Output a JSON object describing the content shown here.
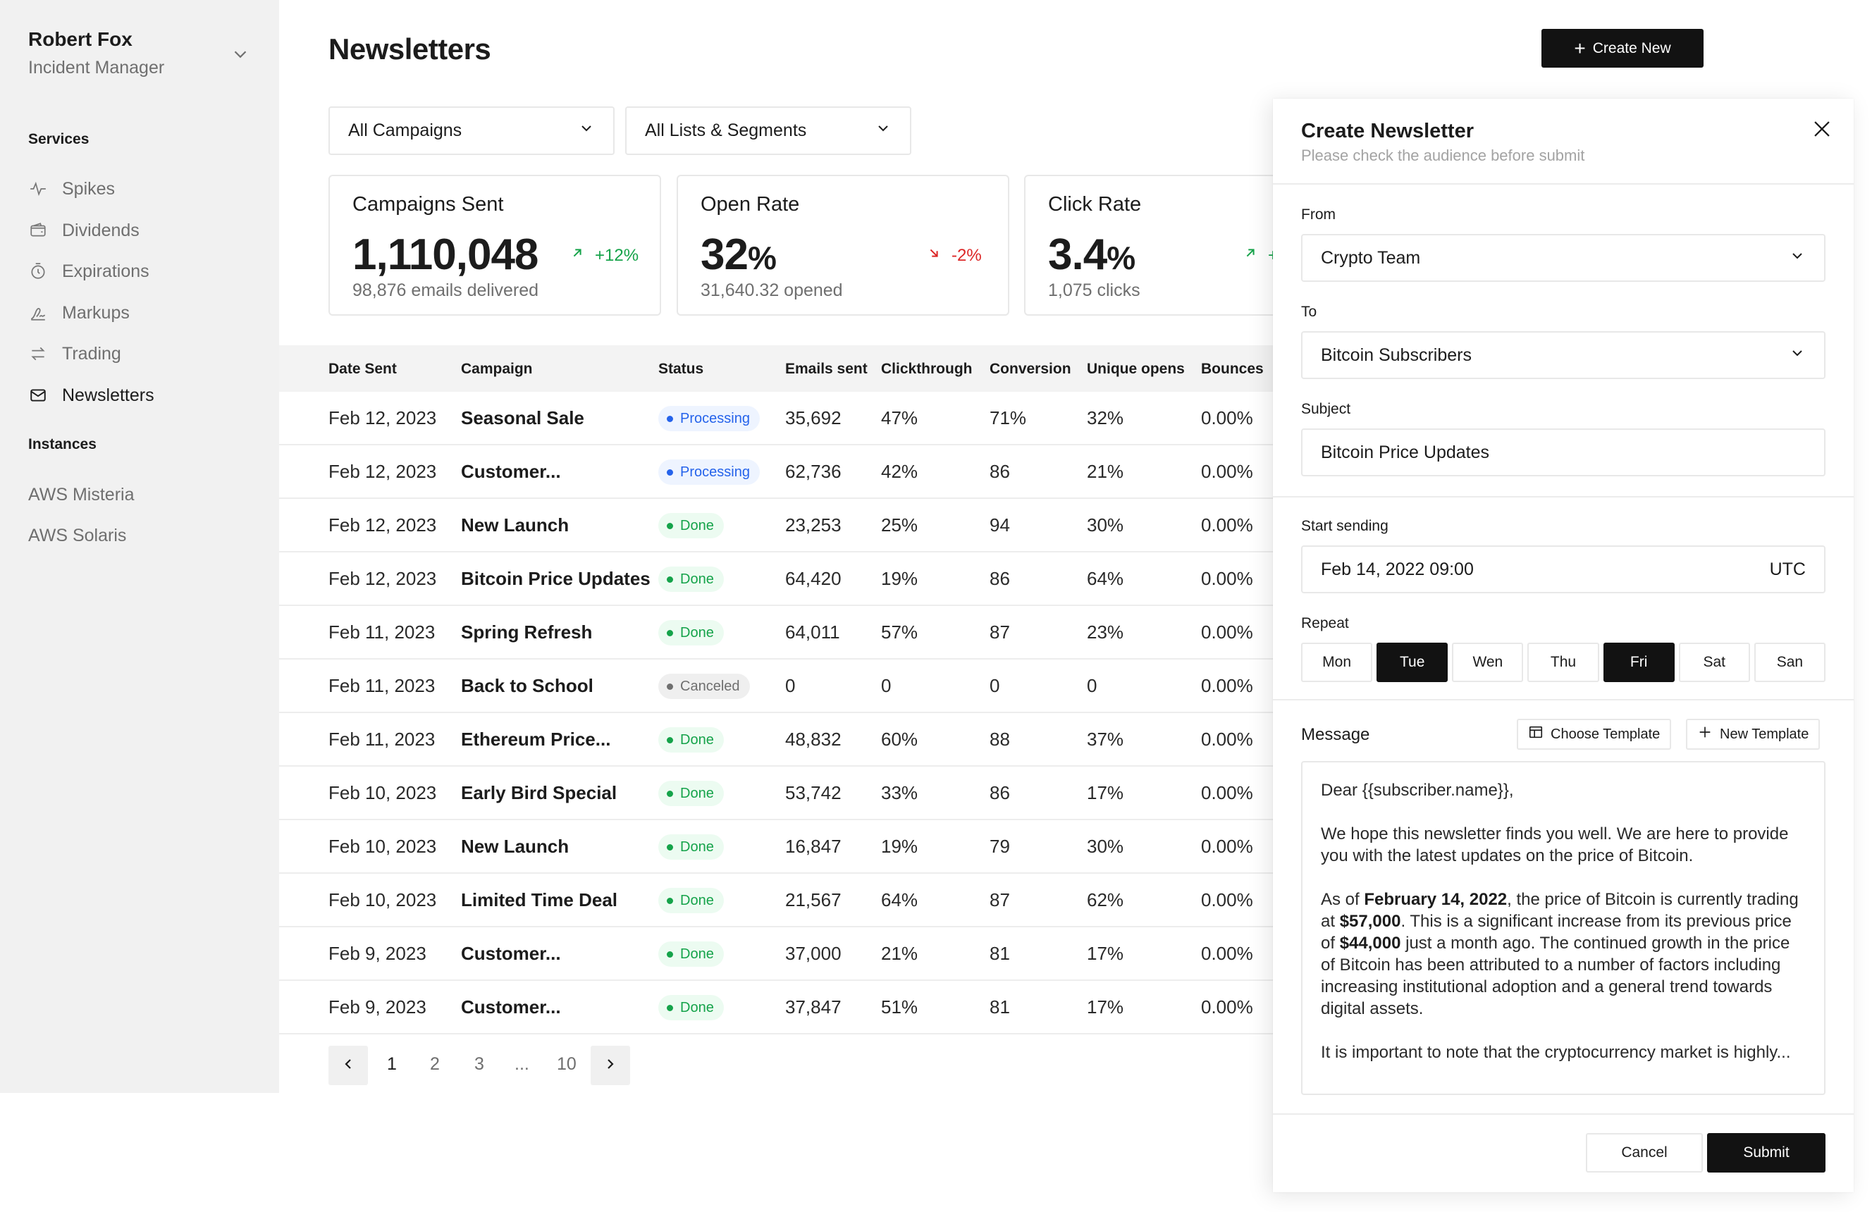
{
  "user": {
    "name": "Robert Fox",
    "role": "Incident Manager",
    "toggle_icon": "chevron-down-icon"
  },
  "sidebar": {
    "services_title": "Services",
    "items": [
      {
        "label": "Spikes",
        "icon": "activity-icon",
        "active": false
      },
      {
        "label": "Dividends",
        "icon": "wallet-icon",
        "active": false
      },
      {
        "label": "Expirations",
        "icon": "timer-icon",
        "active": false
      },
      {
        "label": "Markups",
        "icon": "signature-icon",
        "active": false
      },
      {
        "label": "Trading",
        "icon": "swap-icon",
        "active": false
      },
      {
        "label": "Newsletters",
        "icon": "mail-icon",
        "active": true
      }
    ],
    "instances_title": "Instances",
    "instances": [
      {
        "label": "AWS Misteria"
      },
      {
        "label": "AWS Solaris"
      }
    ]
  },
  "header": {
    "title": "Newsletters",
    "create_label": "Create New"
  },
  "filters": {
    "campaigns": "All Campaigns",
    "lists": "All Lists & Segments"
  },
  "stats": [
    {
      "label": "Campaigns Sent",
      "value": "1,110,048",
      "unit": "",
      "delta": "+12%",
      "trend": "up",
      "sub": "98,876 emails delivered"
    },
    {
      "label": "Open Rate",
      "value": "32",
      "unit": "%",
      "delta": "-2%",
      "trend": "down",
      "sub": "31,640.32 opened"
    },
    {
      "label": "Click Rate",
      "value": "3.4",
      "unit": "%",
      "delta": "+",
      "trend": "up",
      "sub": "1,075 clicks"
    }
  ],
  "table": {
    "headers": [
      "Date Sent",
      "Campaign",
      "Status",
      "Emails sent",
      "Clickthrough",
      "Conversion",
      "Unique opens",
      "Bounces"
    ],
    "rows": [
      {
        "date": "Feb 12, 2023",
        "campaign": "Seasonal Sale",
        "status": "Processing",
        "emails": "35,692",
        "ctr": "47%",
        "conv": "71%",
        "opens": "32%",
        "bounces": "0.00%"
      },
      {
        "date": "Feb 12, 2023",
        "campaign": "Customer...",
        "status": "Processing",
        "emails": "62,736",
        "ctr": "42%",
        "conv": "86",
        "opens": "21%",
        "bounces": "0.00%"
      },
      {
        "date": "Feb 12, 2023",
        "campaign": "New Launch",
        "status": "Done",
        "emails": "23,253",
        "ctr": "25%",
        "conv": "94",
        "opens": "30%",
        "bounces": "0.00%"
      },
      {
        "date": "Feb 12, 2023",
        "campaign": "Bitcoin Price Updates",
        "status": "Done",
        "emails": "64,420",
        "ctr": "19%",
        "conv": "86",
        "opens": "64%",
        "bounces": "0.00%"
      },
      {
        "date": "Feb 11, 2023",
        "campaign": "Spring Refresh",
        "status": "Done",
        "emails": "64,011",
        "ctr": "57%",
        "conv": "87",
        "opens": "23%",
        "bounces": "0.00%"
      },
      {
        "date": "Feb 11, 2023",
        "campaign": "Back to School",
        "status": "Canceled",
        "emails": "0",
        "ctr": "0",
        "conv": "0",
        "opens": "0",
        "bounces": "0.00%"
      },
      {
        "date": "Feb 11, 2023",
        "campaign": "Ethereum Price...",
        "status": "Done",
        "emails": "48,832",
        "ctr": "60%",
        "conv": "88",
        "opens": "37%",
        "bounces": "0.00%"
      },
      {
        "date": "Feb 10, 2023",
        "campaign": "Early Bird Special",
        "status": "Done",
        "emails": "53,742",
        "ctr": "33%",
        "conv": "86",
        "opens": "17%",
        "bounces": "0.00%"
      },
      {
        "date": "Feb 10, 2023",
        "campaign": "New Launch",
        "status": "Done",
        "emails": "16,847",
        "ctr": "19%",
        "conv": "79",
        "opens": "30%",
        "bounces": "0.00%"
      },
      {
        "date": "Feb 10, 2023",
        "campaign": "Limited Time Deal",
        "status": "Done",
        "emails": "21,567",
        "ctr": "64%",
        "conv": "87",
        "opens": "62%",
        "bounces": "0.00%"
      },
      {
        "date": "Feb 9, 2023",
        "campaign": "Customer...",
        "status": "Done",
        "emails": "37,000",
        "ctr": "21%",
        "conv": "81",
        "opens": "17%",
        "bounces": "0.00%"
      },
      {
        "date": "Feb 9, 2023",
        "campaign": "Customer...",
        "status": "Done",
        "emails": "37,847",
        "ctr": "51%",
        "conv": "81",
        "opens": "17%",
        "bounces": "0.00%"
      }
    ]
  },
  "pagination": {
    "pages": [
      "1",
      "2",
      "3",
      "...",
      "10"
    ],
    "current": "1"
  },
  "panel": {
    "title": "Create Newsletter",
    "subtitle": "Please check the audience before submit",
    "from_label": "From",
    "from_value": "Crypto Team",
    "to_label": "To",
    "to_value": "Bitcoin Subscribers",
    "subject_label": "Subject",
    "subject_value": "Bitcoin Price Updates",
    "start_label": "Start sending",
    "start_value": "Feb 14, 2022 09:00",
    "timezone": "UTC",
    "repeat_label": "Repeat",
    "days": [
      {
        "label": "Mon",
        "selected": false
      },
      {
        "label": "Tue",
        "selected": true
      },
      {
        "label": "Wen",
        "selected": false
      },
      {
        "label": "Thu",
        "selected": false
      },
      {
        "label": "Fri",
        "selected": true
      },
      {
        "label": "Sat",
        "selected": false
      },
      {
        "label": "San",
        "selected": false
      }
    ],
    "message_label": "Message",
    "choose_template": "Choose Template",
    "new_template": "New Template",
    "message": {
      "greeting": "Dear {{subscriber.name}},",
      "p1": "We hope this newsletter finds you well. We are here to provide you with the latest updates on the price of Bitcoin.",
      "p2_a": "As of ",
      "p2_date": "February 14, 2022",
      "p2_b": ", the price of Bitcoin is currently trading at ",
      "p2_price": "$57,000",
      "p2_c": ". This is a significant increase from its previous price of ",
      "p2_prev": "$44,000",
      "p2_d": " just a month ago. The continued growth in the price of Bitcoin has been attributed to a number of factors including increasing institutional adoption and a general trend towards digital assets.",
      "p3": "It is important to note that the cryptocurrency market is highly..."
    },
    "cancel_label": "Cancel",
    "submit_label": "Submit"
  }
}
